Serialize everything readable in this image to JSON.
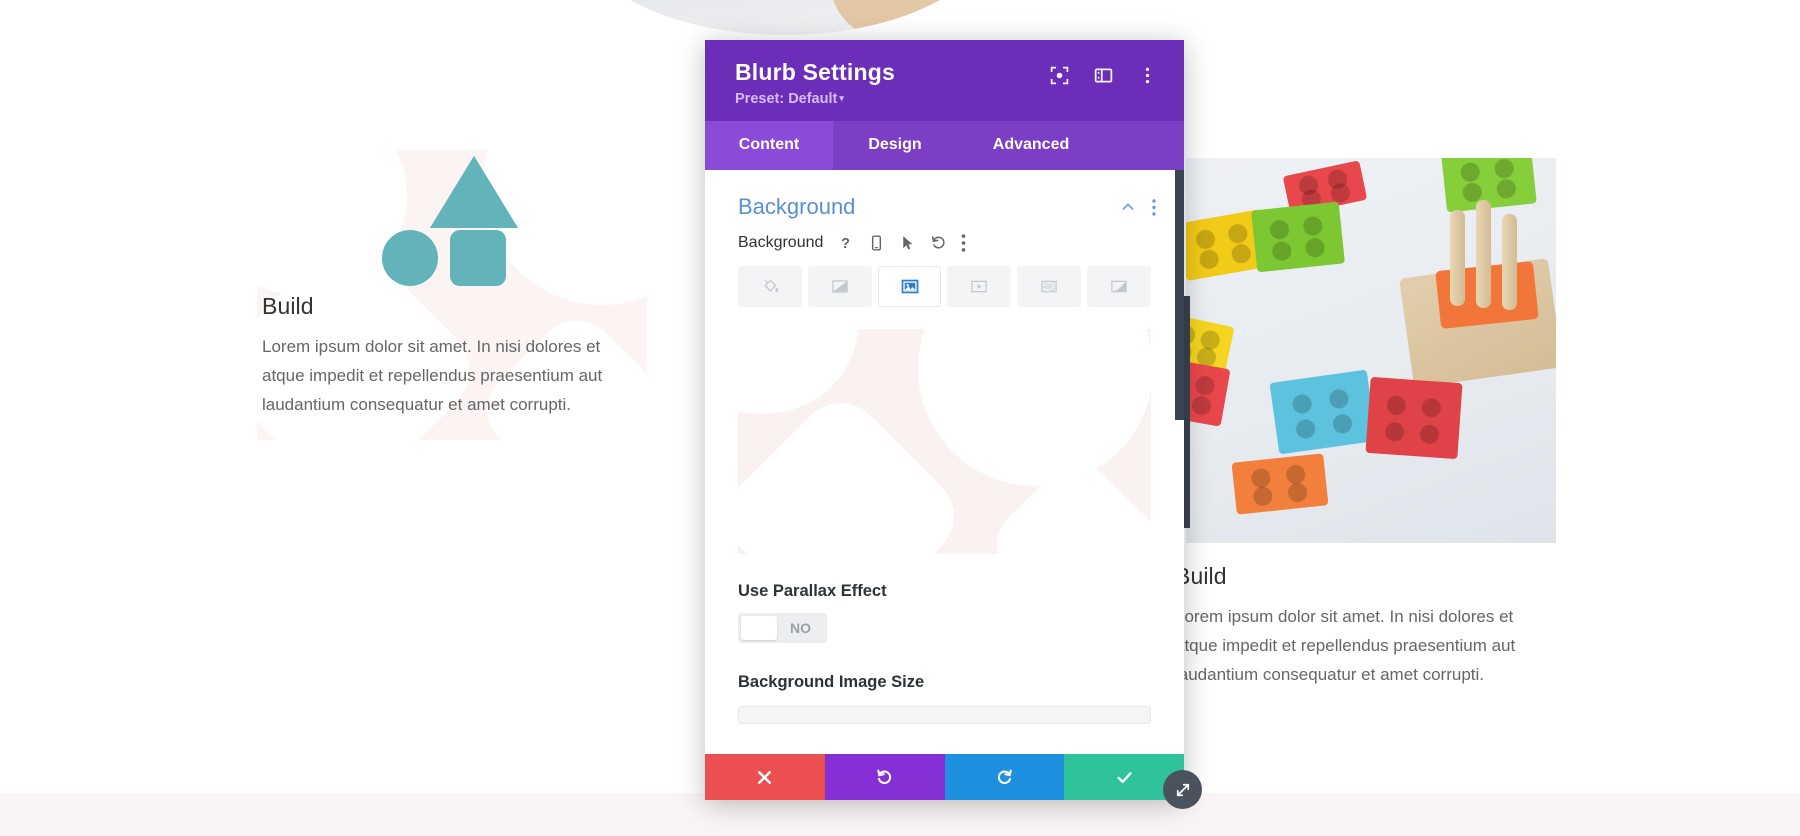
{
  "modal": {
    "title": "Blurb Settings",
    "preset": "Preset: Default",
    "preset_caret": "▾",
    "header_icons": [
      {
        "name": "focus-mode-icon",
        "label": "Focus Mode"
      },
      {
        "name": "panel-layout-icon",
        "label": "Change Layout"
      },
      {
        "name": "more-options-icon",
        "label": "More Options"
      }
    ],
    "tabs": [
      {
        "label": "Content",
        "active": true
      },
      {
        "label": "Design",
        "active": false
      },
      {
        "label": "Advanced",
        "active": false
      }
    ],
    "section": {
      "title": "Background",
      "collapse_icon": "chevron-up-icon",
      "menu_icon": "kebab-menu-icon"
    },
    "background_field": {
      "label": "Background",
      "icons": [
        {
          "name": "help-icon",
          "glyph": "?"
        },
        {
          "name": "responsive-mobile-icon"
        },
        {
          "name": "hover-cursor-icon"
        },
        {
          "name": "reset-icon"
        },
        {
          "name": "kebab-menu-icon"
        }
      ],
      "types": [
        {
          "name": "background-color-tab",
          "label": "Color",
          "active": false
        },
        {
          "name": "background-gradient-tab",
          "label": "Gradient",
          "active": false
        },
        {
          "name": "background-image-tab",
          "label": "Image",
          "active": true
        },
        {
          "name": "background-video-tab",
          "label": "Video",
          "active": false
        },
        {
          "name": "background-pattern-tab",
          "label": "Pattern",
          "active": false
        },
        {
          "name": "background-mask-tab",
          "label": "Mask",
          "active": false
        }
      ],
      "accent_color": "#2d7fd4"
    },
    "parallax": {
      "label": "Use Parallax Effect",
      "value": "NO"
    },
    "image_size": {
      "label": "Background Image Size"
    },
    "footer": [
      {
        "name": "cancel-button",
        "icon": "close-icon",
        "color": "#ec4f4f"
      },
      {
        "name": "undo-button",
        "icon": "undo-icon",
        "color": "#8430d6"
      },
      {
        "name": "redo-button",
        "icon": "redo-icon",
        "color": "#1f8fe0"
      },
      {
        "name": "save-button",
        "icon": "check-icon",
        "color": "#2ec39b"
      }
    ]
  },
  "page": {
    "blurb_left": {
      "title": "Build",
      "body": "Lorem ipsum dolor sit amet. In nisi dolores et atque impedit et repellendus praesentium aut laudantium consequatur et amet corrupti."
    },
    "blurb_right": {
      "title": "Build",
      "body": "Lorem ipsum dolor sit amet. In nisi dolores et atque impedit et repellendus praesentium aut laudantium consequatur et amet corrupti."
    },
    "shape_color": "#63b3bb",
    "blurb_bg_color": "#fbf4f2"
  }
}
